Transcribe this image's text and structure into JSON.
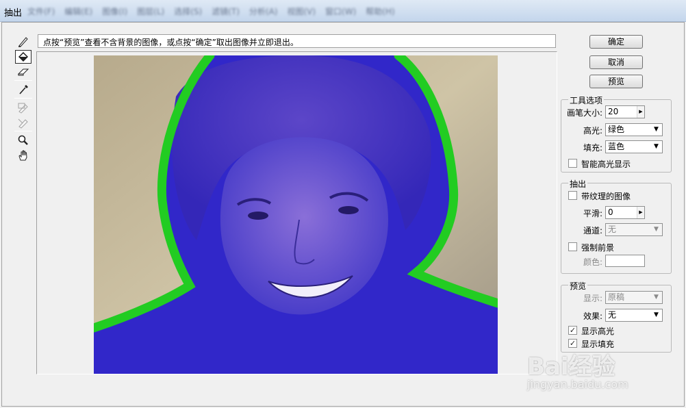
{
  "window": {
    "title": "抽出",
    "menu_items": [
      "文件(F)",
      "编辑(E)",
      "图像(I)",
      "图层(L)",
      "选择(S)",
      "滤镜(T)",
      "分析(A)",
      "视图(V)",
      "窗口(W)",
      "帮助(H)"
    ]
  },
  "toolbox": {
    "tools": [
      {
        "name": "edge-highlighter-icon",
        "active": false,
        "disabled": false
      },
      {
        "name": "fill-icon",
        "active": true,
        "disabled": false
      },
      {
        "name": "eraser-icon",
        "active": false,
        "disabled": false
      },
      {
        "name": "eyedropper-icon",
        "active": false,
        "disabled": false
      },
      {
        "name": "cleanup-icon",
        "active": false,
        "disabled": true
      },
      {
        "name": "edge-touchup-icon",
        "active": false,
        "disabled": true
      },
      {
        "name": "zoom-icon",
        "active": false,
        "disabled": false
      },
      {
        "name": "hand-icon",
        "active": false,
        "disabled": false
      }
    ]
  },
  "instruction": "点按“预览”查看不含背景的图像，或点按“确定”取出图像并立即退出。",
  "buttons": {
    "ok": "确定",
    "cancel": "取消",
    "preview": "预览"
  },
  "tool_options": {
    "title": "工具选项",
    "brush_size_label": "画笔大小:",
    "brush_size_value": "20",
    "highlight_label": "高光:",
    "highlight_value": "绿色",
    "fill_label": "填充:",
    "fill_value": "蓝色",
    "smart_highlight_label": "智能高光显示",
    "smart_highlight_checked": false
  },
  "extraction": {
    "title": "抽出",
    "textured_label": "带纹理的图像",
    "textured_checked": false,
    "smooth_label": "平滑:",
    "smooth_value": "0",
    "channel_label": "通道:",
    "channel_value": "无",
    "force_fg_label": "强制前景",
    "force_fg_checked": false,
    "color_label": "颜色:"
  },
  "preview_group": {
    "title": "预览",
    "show_label": "显示:",
    "show_value": "原稿",
    "effect_label": "效果:",
    "effect_value": "无",
    "show_highlight_label": "显示高光",
    "show_highlight_checked": true,
    "show_fill_label": "显示填充",
    "show_fill_checked": true
  },
  "colors": {
    "highlight": "#22cc22",
    "fill": "#3a2fd0"
  },
  "watermark": {
    "logo": "Bai经验",
    "url": "jingyan.baidu.com"
  }
}
